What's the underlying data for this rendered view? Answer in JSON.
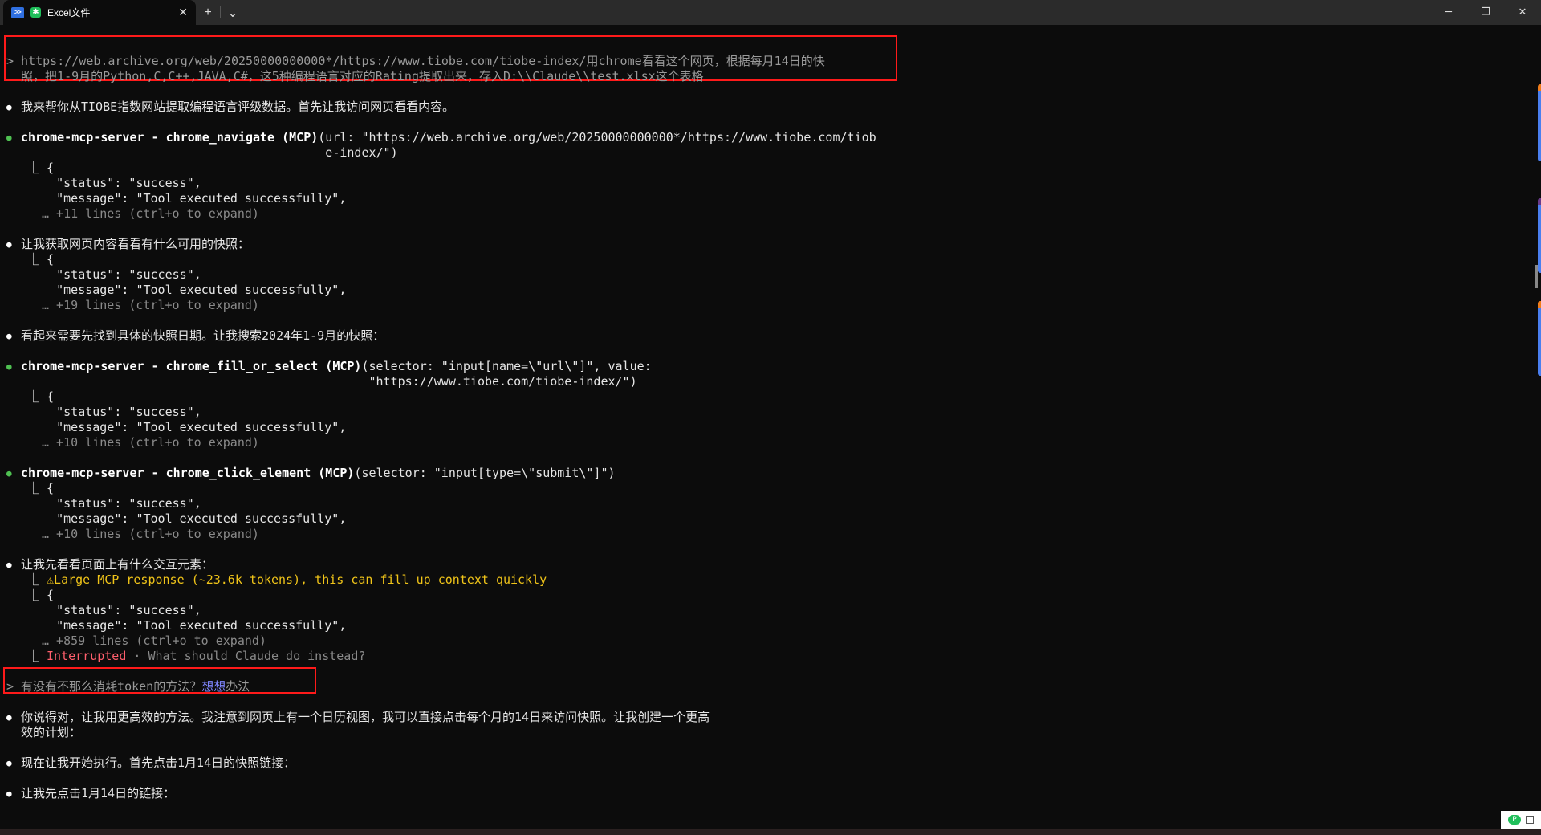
{
  "tab": {
    "title": "Excel文件",
    "close": "✕",
    "new_tab": "+",
    "dropdown": "⌄"
  },
  "window": {
    "minimize": "─",
    "restore": "❐",
    "close": "✕"
  },
  "prompt1": {
    "line1": "> https://web.archive.org/web/20250000000000*/https://www.tiobe.com/tiobe-index/用chrome看看这个网页，根据每月14日的快",
    "line2": "  照，把1-9月的Python,C,C++,JAVA,C#，这5种编程语言对应的Rating提取出来，存入D:\\\\Claude\\\\test.xlsx这个表格"
  },
  "msg1": "我来帮你从TIOBE指数网站提取编程语言评级数据。首先让我访问网页看看内容。",
  "tool1": {
    "name": "chrome-mcp-server - chrome_navigate (MCP)",
    "args1": "(url: \"https://web.archive.org/web/20250000000000*/https://www.tiobe.com/tiob",
    "args2": "                                          e-index/\")",
    "more": "… +11 lines (ctrl+o to expand)"
  },
  "result": {
    "open": "⎿ {",
    "status": "    \"status\": \"success\",",
    "message": "    \"message\": \"Tool executed successfully\","
  },
  "msg2": "让我获取网页内容看看有什么可用的快照：",
  "more2": "… +19 lines (ctrl+o to expand)",
  "msg3": "看起来需要先找到具体的快照日期。让我搜索2024年1-9月的快照：",
  "tool2": {
    "name": "chrome-mcp-server - chrome_fill_or_select (MCP)",
    "args1": "(selector: \"input[name=\\\"url\\\"]\", value:",
    "args2": "                                                \"https://www.tiobe.com/tiobe-index/\")",
    "more": "… +10 lines (ctrl+o to expand)"
  },
  "tool3": {
    "name": "chrome-mcp-server - chrome_click_element (MCP)",
    "args1": "(selector: \"input[type=\\\"submit\\\"]\")",
    "more": "… +10 lines (ctrl+o to expand)"
  },
  "msg4": "让我先看看页面上有什么交互元素：",
  "warning": "⚠Large MCP response (~23.6k tokens), this can fill up context quickly",
  "more4": "… +859 lines (ctrl+o to expand)",
  "interrupted": {
    "label": "Interrupted",
    "hint": " · What should Claude do instead?"
  },
  "prompt2": {
    "prefix": "> 有没有不那么消耗token的方法？",
    "highlight": "想想",
    "suffix": "办法"
  },
  "msg5": {
    "line1": "你说得对，让我用更高效的方法。我注意到网页上有一个日历视图，我可以直接点击每个月的14日来访问快照。让我创建一个更高",
    "line2": "效的计划："
  },
  "msg6": "现在让我开始执行。首先点击1月14日的快照链接：",
  "msg7": "让我先点击1月14日的链接："
}
